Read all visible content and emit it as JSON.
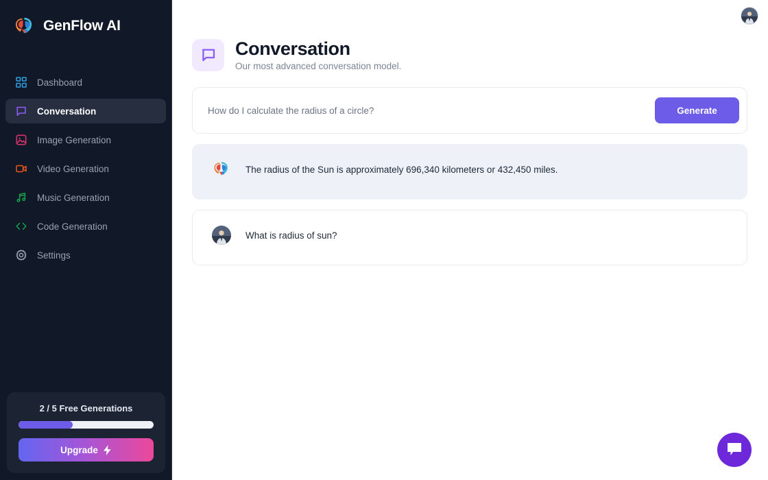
{
  "brand": {
    "name": "GenFlow AI",
    "logo_icon": "brain-logo-icon"
  },
  "sidebar": {
    "items": [
      {
        "label": "Dashboard",
        "icon": "grid-icon",
        "color": "#2f9fe0",
        "active": false
      },
      {
        "label": "Conversation",
        "icon": "chat-bubble-icon",
        "color": "#8b5cf6",
        "active": true
      },
      {
        "label": "Image Generation",
        "icon": "image-icon",
        "color": "#d6336c",
        "active": false
      },
      {
        "label": "Video Generation",
        "icon": "video-camera-icon",
        "color": "#e2551b",
        "active": false
      },
      {
        "label": "Music Generation",
        "icon": "music-note-icon",
        "color": "#16a34a",
        "active": false
      },
      {
        "label": "Code Generation",
        "icon": "code-brackets-icon",
        "color": "#16a34a",
        "active": false
      },
      {
        "label": "Settings",
        "icon": "gear-icon",
        "color": "#9aa3b2",
        "active": false
      }
    ],
    "upgrade": {
      "quota_label": "2 / 5 Free Generations",
      "used": 2,
      "total": 5,
      "progress_percent": 40,
      "button_label": "Upgrade",
      "button_icon": "lightning-bolt-icon"
    }
  },
  "topbar": {
    "avatar": "user-avatar-photo"
  },
  "header": {
    "icon": "chat-bubble-icon",
    "title": "Conversation",
    "subtitle": "Our most advanced conversation model."
  },
  "prompt": {
    "value": "",
    "placeholder": "How do I calculate the radius of a circle?",
    "generate_label": "Generate"
  },
  "messages": [
    {
      "role": "assistant",
      "avatar": "brain-logo-icon",
      "text": "The radius of the Sun is approximately 696,340 kilometers or 432,450 miles."
    },
    {
      "role": "user",
      "avatar": "user-avatar-photo",
      "text": "What is radius of sun?"
    }
  ],
  "fab": {
    "icon": "chat-bubble-filled-icon"
  },
  "colors": {
    "sidebar_bg": "#111827",
    "sidebar_active": "#262e3f",
    "accent": "#6c5ce7",
    "fab": "#6d28d9",
    "assistant_card": "#eef2f8",
    "header_icon_bg": "#f1eafe"
  }
}
